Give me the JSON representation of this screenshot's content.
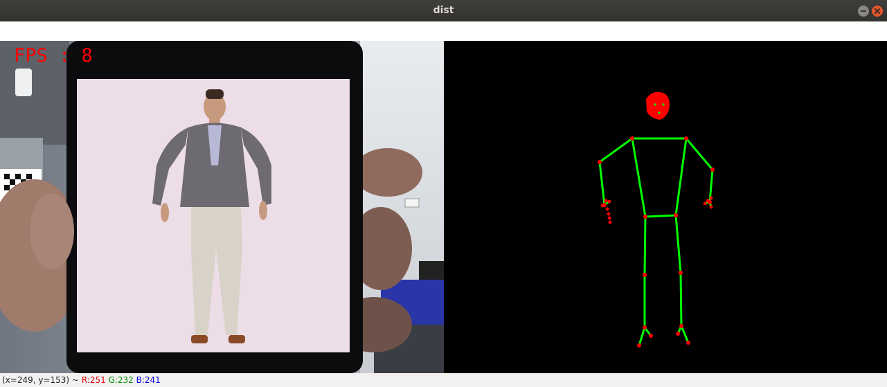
{
  "window": {
    "title": "dist"
  },
  "overlay": {
    "fps_text": "FPS : 8"
  },
  "status": {
    "coords": "(x=249, y=153) ~",
    "r": "R:251",
    "g": "G:232",
    "b": "B:241"
  },
  "colors": {
    "skeleton": "#00ff00",
    "joint": "#ff0000",
    "background": "#000000"
  }
}
